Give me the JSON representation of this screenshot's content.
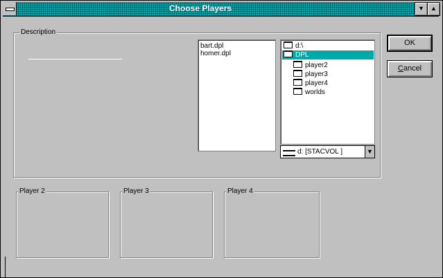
{
  "window": {
    "title": "Choose Players",
    "minimize_glyph": "▼",
    "maximize_glyph": "▲"
  },
  "description": {
    "label": "Description"
  },
  "files": {
    "items": [
      "bart.dpl",
      "homer.dpl"
    ]
  },
  "directories": {
    "items": [
      {
        "label": "d:\\",
        "selected": false,
        "icon": "open-folder-icon"
      },
      {
        "label": "DPL",
        "selected": true,
        "icon": "open-folder-icon"
      },
      {
        "label": "player2",
        "selected": false,
        "icon": "folder-icon"
      },
      {
        "label": "player3",
        "selected": false,
        "icon": "folder-icon"
      },
      {
        "label": "player4",
        "selected": false,
        "icon": "folder-icon"
      },
      {
        "label": "worlds",
        "selected": false,
        "icon": "folder-icon"
      }
    ]
  },
  "drive": {
    "value": "d: [STACVOL ]",
    "arrow_glyph": "▼"
  },
  "buttons": {
    "ok": "OK",
    "cancel_prefix": "",
    "cancel_underlined": "C",
    "cancel_rest": "ancel"
  },
  "players": {
    "player2": "Player 2",
    "player3": "Player 3",
    "player4": "Player 4"
  },
  "colors": {
    "accent": "#00a8a8",
    "face": "#c0c0c0"
  }
}
